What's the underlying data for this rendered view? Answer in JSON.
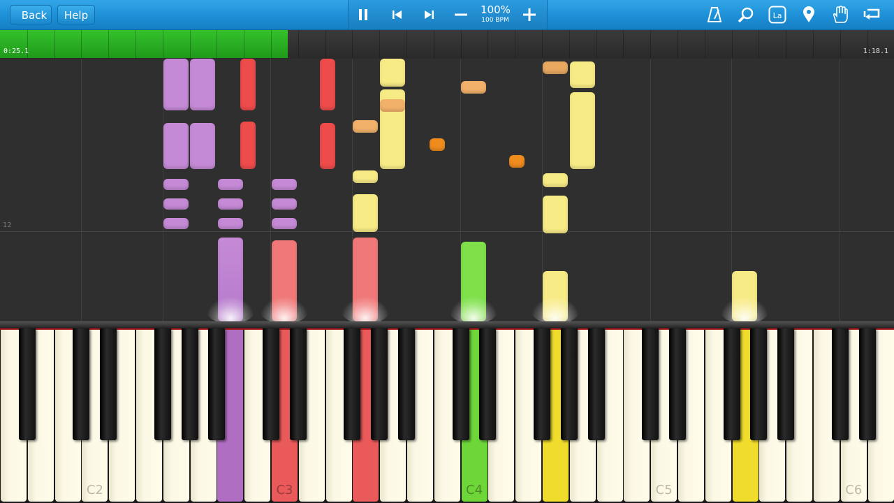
{
  "toolbar": {
    "back_label": "Back",
    "help_label": "Help",
    "speed_percent": "100%",
    "speed_bpm": "100 BPM",
    "icons": [
      "pause-icon",
      "previous-icon",
      "next-icon",
      "minus-icon",
      "plus-icon",
      "metronome-icon",
      "zoom-icon",
      "note-label-icon",
      "marker-icon",
      "hand-icon",
      "loop-icon"
    ],
    "note_label_glyph": "La"
  },
  "progress": {
    "current_time": "0:25.1",
    "total_time": "1:18.1",
    "fraction": 0.322
  },
  "roll": {
    "measure_number": "12"
  },
  "keyboard": {
    "octave_labels": [
      "C2",
      "C3",
      "C4",
      "C5",
      "C6"
    ],
    "lit_key_colors": {
      "purple": "#b06ec2",
      "red": "#ea5a5a",
      "green": "#6fd63a",
      "yellow": "#f0dc2c"
    }
  },
  "colors": {
    "toolbar_blue": "#1d8fd6",
    "progress_green": "#2eb52a",
    "note_purple": "#c58ad6",
    "note_red": "#ee4b4b",
    "note_yellow": "#f7eb86",
    "note_orange": "#f7a33e",
    "note_green": "#7fe04a"
  }
}
